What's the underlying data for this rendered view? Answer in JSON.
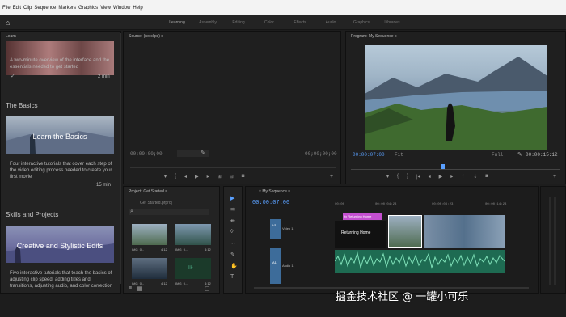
{
  "menu": [
    "File",
    "Edit",
    "Clip",
    "Sequence",
    "Markers",
    "Graphics",
    "View",
    "Window",
    "Help"
  ],
  "workspace_tabs": [
    "Learning",
    "Assembly",
    "Editing",
    "Color",
    "Effects",
    "Audio",
    "Graphics",
    "Libraries"
  ],
  "learn": {
    "panel_title": "Learn",
    "intro_text": "A two-minute overview of the interface and the essentials needed to get started",
    "intro_duration": "2 min",
    "section1": "The Basics",
    "card1_title": "Learn the Basics",
    "card1_desc": "Four interactive tutorials that cover each step of the video editing process needed to create your first movie",
    "card1_duration": "15 min",
    "section2": "Skills and Projects",
    "card2_title": "Creative and Stylistic Edits",
    "card2_desc": "Five interactive tutorials that teach the basics of adjusting clip speed, adding titles and transitions, adjusting audio, and color correction"
  },
  "source": {
    "title": "Source: (no clips)",
    "tc_left": "00;00;00;00",
    "tc_right": "00;00;00;00"
  },
  "program": {
    "title": "Program: My Sequence",
    "tc_left": "00:00:07:00",
    "fit": "Fit",
    "quality": "Full",
    "tc_right": "00:00:15:12"
  },
  "project": {
    "title": "Project: Get Started",
    "file": "Get Started.prproj",
    "item1": "IMG_0...",
    "item1_dur": "4:12",
    "item2": "IMG_0...",
    "item2_dur": "4:12",
    "item3": "IMG_0...",
    "item3_dur": "4:12",
    "item4": "IMG_0...",
    "item4_dur": "4:12"
  },
  "timeline": {
    "title": "My Sequence",
    "timecode": "00:00:07:00",
    "ruler": [
      "00:00",
      "00:00:04:23",
      "00:00:09:23",
      "00:00:14:23"
    ],
    "title_clip": "fx  Returning Home",
    "title_text": "Returning Home",
    "v1": "V1",
    "a1": "A1",
    "video_label": "Video 1",
    "audio_label": "Audio 1"
  },
  "watermark": "掘金技术社区 @ 一罐小可乐",
  "colors": {
    "accent": "#5aa0ff",
    "audio": "#4fb08a",
    "title_clip": "#c44fd0",
    "video_clip": "#6a8fb0"
  }
}
